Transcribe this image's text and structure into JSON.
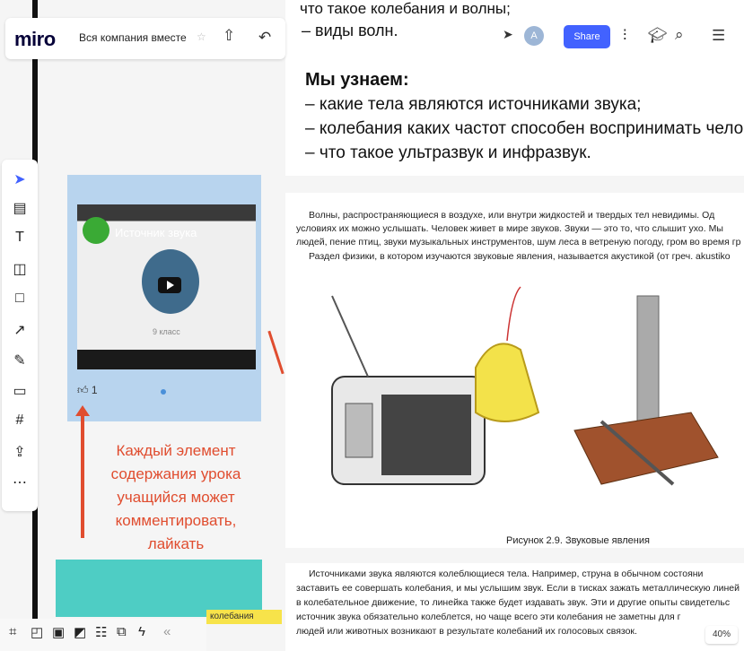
{
  "app": {
    "logo": "miro",
    "board_name": "Вся компания вместе",
    "share_label": "Share",
    "avatar_initial": "A",
    "zoom": "40%"
  },
  "doc": {
    "top_line": "что такое колебания и волны;",
    "types_line": "– виды волн.",
    "learn_heading": "Мы узнаем:",
    "learn_items": [
      "– какие тела являются источниками звука;",
      "– колебания каких частот способен воспринимать человек;",
      "– что такое ультразвук и инфразвук."
    ],
    "para1": [
      "Волны, распространяющиеся в воздухе, или внутри жидкостей и твердых тел невидимы. Од",
      "условиях их можно услышать. Человек живет в мире звуков. Звуки — это то, что слышит ухо. Мы",
      "людей, пение птиц, звуки музыкальных инструментов, шум леса в ветреную погоду, гром во время гр",
      "Раздел физики, в котором изучаются звуковые явления, называется акустикой (от греч. akustiko"
    ],
    "figure_caption": "Рисунок 2.9. Звуковые явления",
    "para2": [
      "Источниками звука являются колеблющиеся тела. Например, струна в обычном состояни",
      "заставить ее совершать колебания, и мы услышим звук. Если в тисках зажать металлическую линей",
      "в колебательное движение, то линейка также будет издавать звук. Эти и другие опыты свидетельс",
      "источник звука обязательно колеблется, но чаще всего эти колебания не заметны для г",
      "людей или животных возникают в результате колебаний их голосовых связок."
    ]
  },
  "video": {
    "title": "Источник звука",
    "grade": "9 класс",
    "likes": "1"
  },
  "annotation": {
    "text": "Каждый элемент содержания урока учащийся может комментировать, лайкать"
  },
  "sticker": {
    "text": "колебания"
  }
}
